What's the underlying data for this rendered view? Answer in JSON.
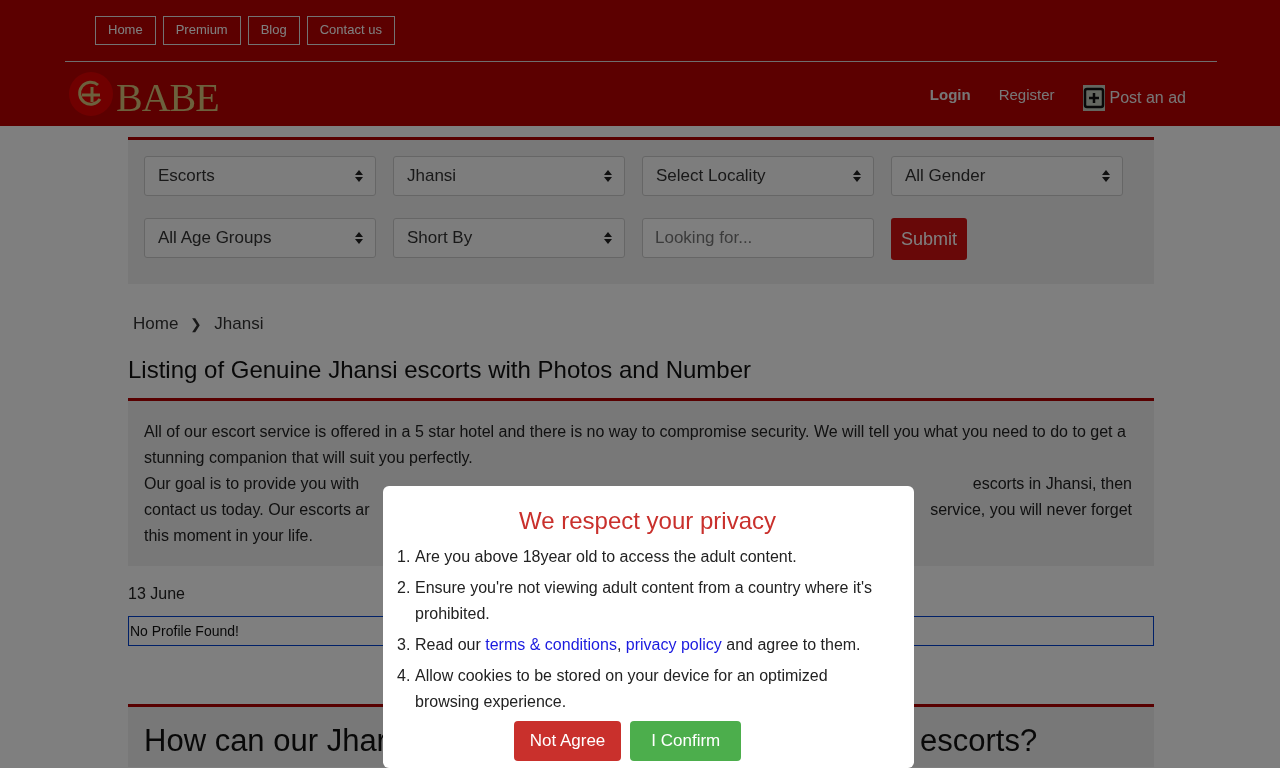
{
  "top_nav": [
    {
      "label": "Home"
    },
    {
      "label": "Premium"
    },
    {
      "label": "Blog"
    },
    {
      "label": "Contact us"
    }
  ],
  "logo": {
    "text": "BABE"
  },
  "account": {
    "login": "Login",
    "register": "Register",
    "post_ad": "Post an ad"
  },
  "filters": [
    {
      "kind": "select",
      "value": "Escorts"
    },
    {
      "kind": "select",
      "value": "Jhansi"
    },
    {
      "kind": "select",
      "value": "Select Locality"
    },
    {
      "kind": "select",
      "value": "All Gender"
    },
    {
      "kind": "select",
      "value": "All Age Groups"
    },
    {
      "kind": "select",
      "value": "Short By"
    },
    {
      "kind": "input",
      "placeholder": "Looking for..."
    },
    {
      "kind": "button",
      "label": "Submit"
    }
  ],
  "breadcrumb": {
    "items": [
      "Home",
      "Jhansi"
    ],
    "separator": "❯"
  },
  "page_title": "Listing of Genuine Jhansi escorts with Photos and Number",
  "intro": {
    "line_1": "All of our escort service is offered in a 5 star hotel and there is no way to compromise security. We will tell you what you need to do to get a stunning companion that will suit you perfectly.",
    "line_2_start": "Our goal is to provide you with",
    "line_2_end": "escorts in Jhansi, then",
    "line_3_start": "contact us today. Our escorts ar",
    "line_3_end": "service, you will never forget",
    "line_4": "this moment in your life."
  },
  "date": "13 June",
  "notice": "No Profile Found!",
  "section_heading": {
    "start": "How can our Jhar",
    "end": "escorts?"
  },
  "modal": {
    "title": "We respect your privacy",
    "items": [
      {
        "number": "1.",
        "parts": [
          {
            "kind": "text",
            "text": "Are you above 18year old to access the adult content."
          }
        ]
      },
      {
        "number": "2.",
        "parts": [
          {
            "kind": "text",
            "text": "Ensure you're not viewing adult content from a country where it's prohibited."
          }
        ]
      },
      {
        "number": "3.",
        "parts": [
          {
            "kind": "text",
            "text": "Read our "
          },
          {
            "kind": "link",
            "text": "terms & conditions"
          },
          {
            "kind": "text",
            "text": ", "
          },
          {
            "kind": "link",
            "text": "privacy policy"
          },
          {
            "kind": "text",
            "text": " and agree to them."
          }
        ]
      },
      {
        "number": "4.",
        "parts": [
          {
            "kind": "text",
            "text": "Allow cookies to be stored on your device for an optimized browsing experience."
          }
        ]
      }
    ],
    "buttons": [
      {
        "kind": "decline",
        "label": "Not Agree"
      },
      {
        "kind": "confirm",
        "label": "I Confirm"
      }
    ]
  }
}
